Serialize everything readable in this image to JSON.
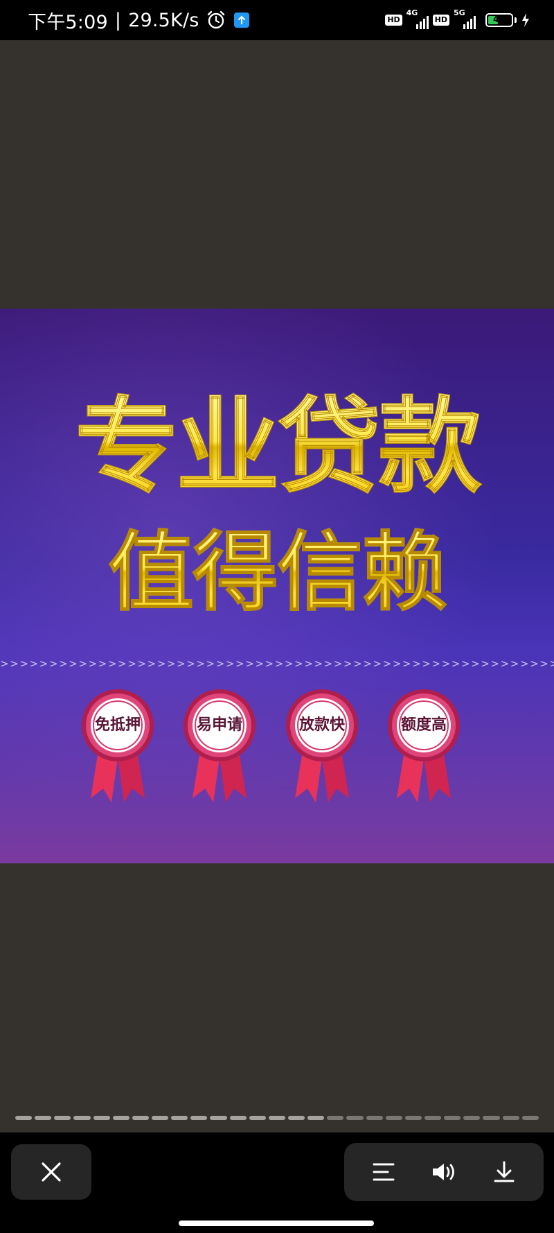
{
  "status_bar": {
    "time": "下午5:09",
    "separator": "|",
    "net_speed": "29.5K/s",
    "icons": [
      "alarm-icon",
      "upload-notification-icon",
      "hd-icon",
      "signal-4g-icon",
      "hd-icon",
      "signal-5g-icon",
      "battery-icon",
      "charging-icon"
    ],
    "hd_label": "HD",
    "net1_label": "4G",
    "net2_label": "5G",
    "battery_level": "43",
    "battery_fraction": 0.43
  },
  "ad": {
    "title_line1": "专业贷款",
    "title_line2": "值得信赖",
    "chevrons": ">>>>>>>>>>>>>>>>>>>>>>>>>>>>>>>>>>>>>>>>>>>>>>>>>>>>>>>>>>>>>>",
    "badges": [
      {
        "text": "免抵押"
      },
      {
        "text": "易申请"
      },
      {
        "text": "放款快"
      },
      {
        "text": "额度高"
      }
    ],
    "colors": {
      "title_gold": "#ffe94a",
      "badge_red": "#d8245c",
      "background_purple": "#3a2aa0"
    }
  },
  "viewer": {
    "progress_total": 27,
    "progress_current": 16,
    "buttons": {
      "close": "close-icon",
      "menu": "menu-icon",
      "sound": "volume-icon",
      "download": "download-icon"
    }
  }
}
